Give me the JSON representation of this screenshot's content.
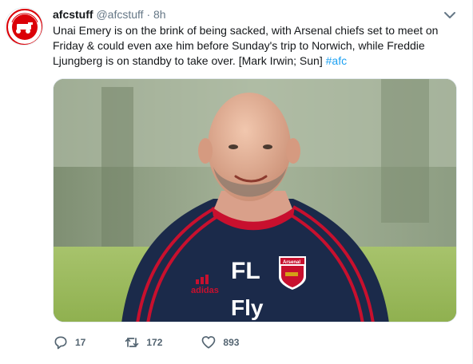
{
  "tweet": {
    "author_name": "afcstuff",
    "handle": "@afcstuff",
    "separator": "·",
    "time": "8h",
    "text_main": "Unai Emery is on the brink of being sacked, with Arsenal chiefs set to meet on Friday & could even axe him before Sunday's trip to Norwich, while Freddie Ljungberg is on standby to take over. [Mark Irwin; Sun] ",
    "hashtag": "#afc",
    "media": {
      "jersey_initials": "FL",
      "jersey_sponsor": "Fly",
      "brand": "adidas",
      "crest_text": "Arsenal"
    },
    "actions": {
      "replies": "17",
      "retweets": "172",
      "likes": "893"
    }
  },
  "colors": {
    "link": "#1da1f2",
    "jersey": "#1b2a4a",
    "stripe": "#c8102e",
    "secondary_text": "#657786"
  },
  "icons": {
    "reply": "reply-icon",
    "retweet": "retweet-icon",
    "like": "heart-icon",
    "caret": "chevron-down-icon"
  }
}
